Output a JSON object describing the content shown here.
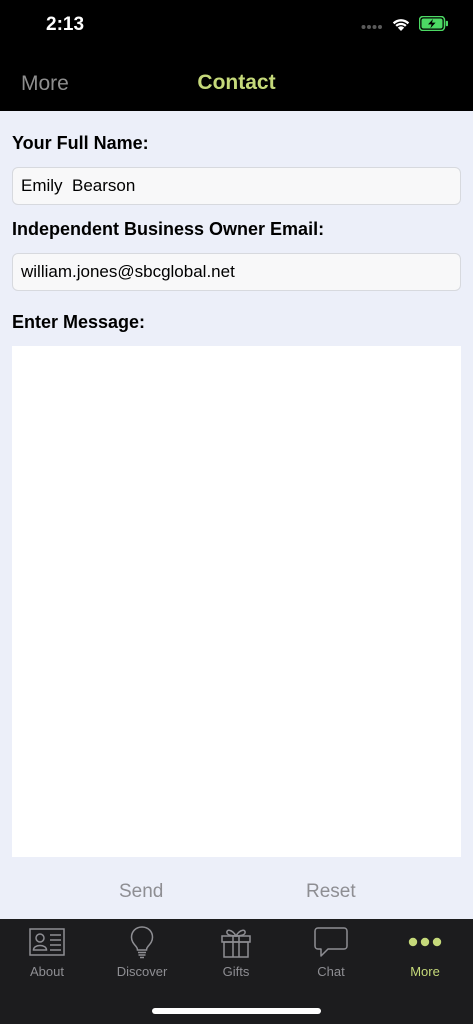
{
  "status_bar": {
    "time": "2:13",
    "icons": [
      "signal-dots-icon",
      "wifi-icon",
      "battery-charging-icon"
    ]
  },
  "nav": {
    "back_label": "More",
    "title": "Contact"
  },
  "form": {
    "name_label": "Your Full Name:",
    "name_value": "Emily  Bearson",
    "email_label": "Independent Business Owner Email:",
    "email_value": "william.jones@sbcglobal.net",
    "message_label": "Enter Message:",
    "message_value": "",
    "send_label": "Send",
    "reset_label": "Reset"
  },
  "tab_bar": {
    "items": [
      {
        "label": "About",
        "icon": "contact-card-icon"
      },
      {
        "label": "Discover",
        "icon": "lightbulb-icon"
      },
      {
        "label": "Gifts",
        "icon": "gift-icon"
      },
      {
        "label": "Chat",
        "icon": "chat-bubble-icon"
      },
      {
        "label": "More",
        "icon": "more-dots-icon",
        "active": true
      }
    ]
  },
  "colors": {
    "accent": "#c5d97a",
    "inactive": "#8e8e93",
    "background": "#eceff9",
    "bar": "#1c1c1e"
  }
}
